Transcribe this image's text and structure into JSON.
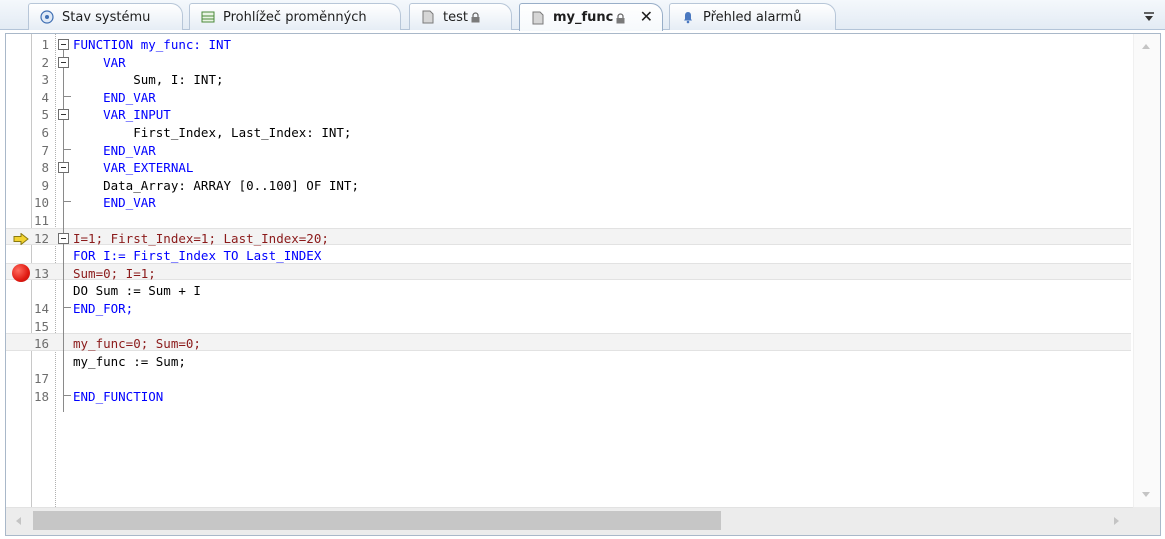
{
  "tabs": [
    {
      "label": "Stav systému",
      "icon": "system-status-icon",
      "locked": false,
      "active": false
    },
    {
      "label": "Prohlížeč proměnných",
      "icon": "variable-viewer-icon",
      "locked": false,
      "active": false
    },
    {
      "label": "test",
      "icon": "document-icon",
      "locked": true,
      "active": false
    },
    {
      "label": "my_func",
      "icon": "document-icon",
      "locked": true,
      "active": true
    },
    {
      "label": "Přehled alarmů",
      "icon": "alarm-bell-icon",
      "locked": false,
      "active": false
    }
  ],
  "editor": {
    "lines": [
      {
        "num": "1",
        "text": "FUNCTION my_func: INT"
      },
      {
        "num": "2",
        "text": "    VAR"
      },
      {
        "num": "3",
        "text": "        Sum, I: INT;"
      },
      {
        "num": "4",
        "text": "    END_VAR"
      },
      {
        "num": "5",
        "text": "    VAR_INPUT"
      },
      {
        "num": "6",
        "text": "        First_Index, Last_Index: INT;"
      },
      {
        "num": "7",
        "text": "    END_VAR"
      },
      {
        "num": "8",
        "text": "    VAR_EXTERNAL"
      },
      {
        "num": "9",
        "text": "    Data_Array: ARRAY [0..100] OF INT;"
      },
      {
        "num": "10",
        "text": "    END_VAR"
      },
      {
        "num": "11",
        "text": ""
      },
      {
        "num": "12",
        "text": "I=1; First_Index=1; Last_Index=20;"
      },
      {
        "num": "",
        "text": "FOR I:= First_Index TO Last_INDEX"
      },
      {
        "num": "13",
        "text": "Sum=0; I=1;"
      },
      {
        "num": "",
        "text": "DO Sum := Sum + I"
      },
      {
        "num": "14",
        "text": "END_FOR;"
      },
      {
        "num": "15",
        "text": ""
      },
      {
        "num": "16",
        "text": "my_func=0; Sum=0;"
      },
      {
        "num": "",
        "text": "my_func := Sum;"
      },
      {
        "num": "17",
        "text": ""
      },
      {
        "num": "18",
        "text": "END_FUNCTION"
      }
    ],
    "breakpoint_line": "13",
    "execution_line": "12"
  },
  "colors": {
    "keyword": "#0000ff",
    "debug_value": "#8b1a1a",
    "breakpoint": "#e01a12",
    "exec_arrow": "#f2d230"
  }
}
